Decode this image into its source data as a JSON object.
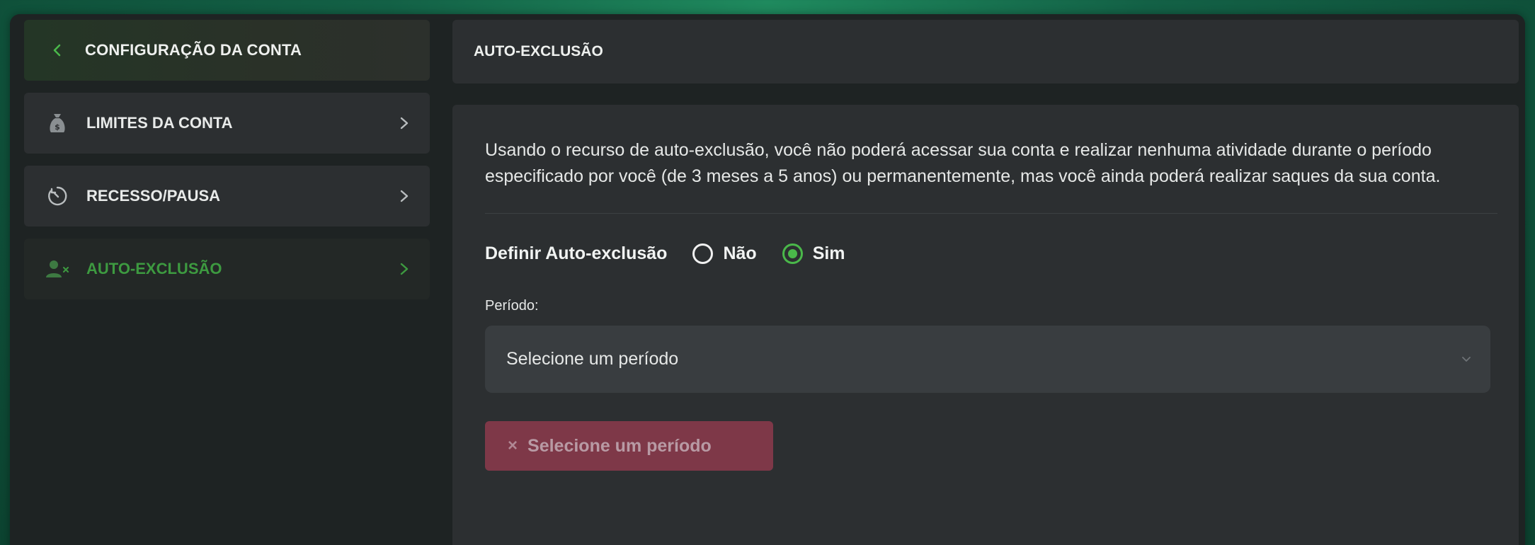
{
  "sidebar": {
    "header": {
      "label": "CONFIGURAÇÃO DA CONTA",
      "icon": "chevron-left-icon"
    },
    "items": [
      {
        "label": "LIMITES DA CONTA",
        "icon": "money-bag-icon",
        "active": false
      },
      {
        "label": "RECESSO/PAUSA",
        "icon": "timer-icon",
        "active": false
      },
      {
        "label": "AUTO-EXCLUSÃO",
        "icon": "user-x-icon",
        "active": true
      }
    ]
  },
  "content": {
    "title": "AUTO-EXCLUSÃO",
    "description": "Usando o recurso de auto-exclusão, você não poderá acessar sua conta e realizar nenhuma atividade durante o período especificado por você (de 3 meses a 5 anos) ou permanentemente, mas você ainda poderá realizar saques da sua conta.",
    "toggle": {
      "label": "Definir Auto-exclusão",
      "options": [
        {
          "label": "Não",
          "checked": false
        },
        {
          "label": "Sim",
          "checked": true
        }
      ]
    },
    "period": {
      "label": "Período:",
      "placeholder": "Selecione um período"
    },
    "submit": {
      "icon": "×",
      "label": "Selecione um período"
    }
  },
  "colors": {
    "accent_green": "#4ab84a",
    "active_text_green": "#3d9a40",
    "button_disabled": "#7e3848",
    "panel_bg": "#2c2f31",
    "page_bg": "#1e2323"
  }
}
